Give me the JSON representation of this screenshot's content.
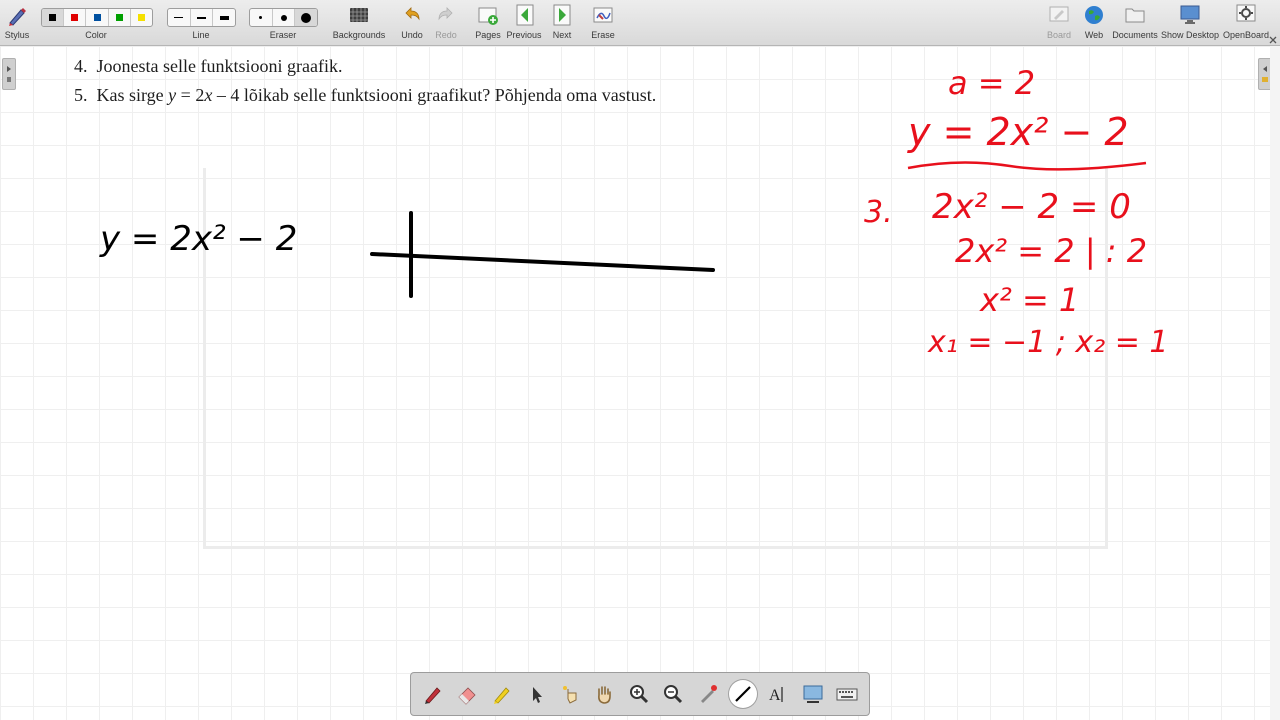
{
  "toolbar": {
    "stylus_label": "Stylus",
    "color_label": "Color",
    "line_label": "Line",
    "eraser_label": "Eraser",
    "backgrounds_label": "Backgrounds",
    "undo_label": "Undo",
    "redo_label": "Redo",
    "pages_label": "Pages",
    "previous_label": "Previous",
    "next_label": "Next",
    "erase_label": "Erase",
    "board_label": "Board",
    "web_label": "Web",
    "documents_label": "Documents",
    "show_desktop_label": "Show Desktop",
    "openboard_label": "OpenBoard",
    "colors": [
      "#000000",
      "#e00000",
      "#0050a0",
      "#00a000",
      "#f5e000"
    ]
  },
  "document": {
    "line4_number": "4.",
    "line4_text": "Joonesta selle funktsiooni graafik.",
    "line5_number": "5.",
    "line5_a": "Kas sirge ",
    "line5_var_y": "y",
    "line5_b": " = 2",
    "line5_var_x": "x",
    "line5_c": " – 4 lõikab selle funktsiooni graafikut? Põhjenda oma vastust."
  },
  "handwriting": {
    "black_equation": "y = 2x² − 2",
    "red_a": "a = 2",
    "red_y": "y = 2x² − 2",
    "step3_number": "3.",
    "step3_eq": "2x² − 2 = 0",
    "eq2": "2x² = 2 | : 2",
    "eq3": "x² = 1",
    "roots": "x₁ = −1 ;  x₂ = 1"
  },
  "ink_colors": {
    "red": "#e8101c",
    "black": "#000000"
  },
  "palette_icons": [
    "pen-icon",
    "eraser-icon",
    "marker-icon",
    "pointer-icon",
    "laser-pointer-icon",
    "hand-icon",
    "zoom-in-icon",
    "zoom-out-icon",
    "draw-line-icon",
    "text-icon",
    "capture-icon",
    "keyboard-icon"
  ]
}
